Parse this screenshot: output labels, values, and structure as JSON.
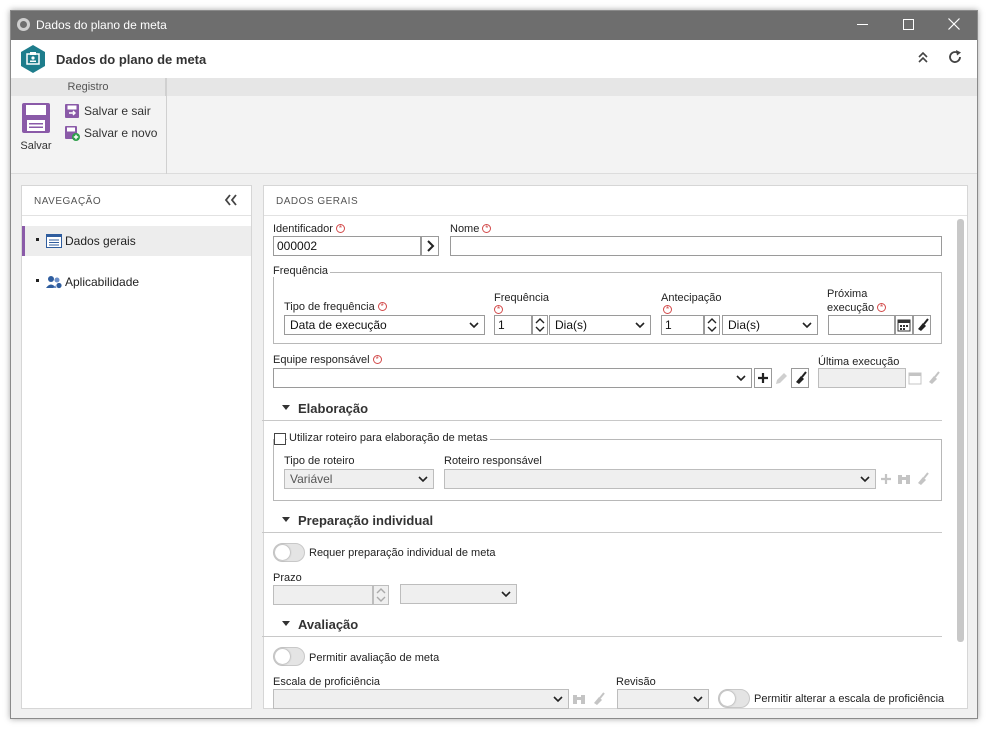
{
  "window": {
    "title": "Dados do plano de meta"
  },
  "header": {
    "title": "Dados do plano de meta"
  },
  "ribbon": {
    "group_label": "Registro",
    "save_label": "Salvar",
    "save_exit_label": "Salvar e sair",
    "save_new_label": "Salvar e novo"
  },
  "navigation": {
    "title": "NAVEGAÇÃO",
    "items": [
      {
        "label": "Dados gerais",
        "active": true
      },
      {
        "label": "Aplicabilidade",
        "active": false
      }
    ]
  },
  "form": {
    "title": "DADOS GERAIS",
    "identifier_label": "Identificador",
    "identifier_value": "000002",
    "name_label": "Nome",
    "name_value": "",
    "frequency_group_label": "Frequência",
    "frequency_type_label": "Tipo de frequência",
    "frequency_type_value": "Data de execução",
    "frequency_label": "Frequência",
    "frequency_value": "1",
    "frequency_unit": "Dia(s)",
    "anticipation_label": "Antecipação",
    "anticipation_value": "1",
    "anticipation_unit": "Dia(s)",
    "next_execution_label_1": "Próxima",
    "next_execution_label_2": "execução",
    "next_execution_value": "",
    "team_label": "Equipe responsável",
    "team_value": "",
    "last_execution_label": "Última execução",
    "last_execution_value": ""
  },
  "elaboracao": {
    "title": "Elaboração",
    "use_script_label": "Utilizar roteiro para elaboração de metas",
    "script_type_label": "Tipo de roteiro",
    "script_type_value": "Variável",
    "script_responsible_label": "Roteiro responsável",
    "script_responsible_value": ""
  },
  "preparacao": {
    "title": "Preparação individual",
    "requires_label": "Requer preparação individual de meta",
    "deadline_label": "Prazo",
    "deadline_value": "",
    "deadline_unit": ""
  },
  "avaliacao": {
    "title": "Avaliação",
    "allow_label": "Permitir avaliação de meta",
    "scale_label": "Escala de proficiência",
    "scale_value": "",
    "review_label": "Revisão",
    "review_value": "",
    "allow_change_scale_label": "Permitir alterar a escala de proficiência"
  },
  "colors": {
    "titlebar": "#6e6e6e",
    "accent_purple": "#8a5aa8",
    "logo_teal": "#1e7d8c",
    "required_red": "#d24a4a"
  }
}
